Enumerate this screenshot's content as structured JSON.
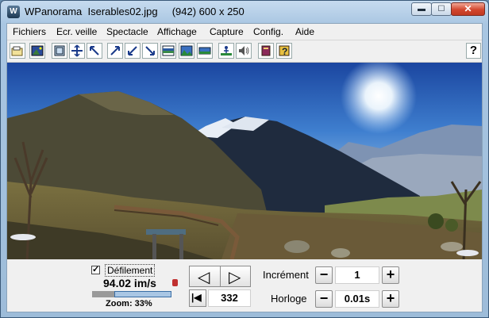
{
  "window": {
    "app_name": "WPanorama",
    "file_name": "Iserables02.jpg",
    "image_info": "(942) 600 x 250",
    "title_full": "WPanorama  Iserables02.jpg     (942) 600 x 250",
    "app_icon_glyph": "W",
    "min_glyph": "▬",
    "max_glyph": "☐",
    "close_glyph": "✕"
  },
  "menu": [
    "Fichiers",
    "Ecr. veille",
    "Spectacle",
    "Affichage",
    "Capture",
    "Config.",
    "Aide"
  ],
  "toolbar": {
    "buttons": [
      "open-icon",
      "image-icon",
      "fit-window-icon",
      "expand-icon",
      "zoom-out-icon",
      "zoom-in-icon",
      "shrink-icon",
      "move-corner-icon",
      "panorama-strip-icon",
      "landscape-icon",
      "flat-panorama-icon",
      "person-icon",
      "sound-icon",
      "book-icon",
      "help-book-icon"
    ],
    "help_glyph": "?"
  },
  "controls": {
    "scroll_label": "Défilement",
    "scroll_checked": true,
    "check_glyph": "✓",
    "fps": "94.02 im/s",
    "zoom": "Zoom: 33%",
    "zoom_level": 0.72,
    "prev_glyph": "◁",
    "next_glyph": "▷",
    "first_glyph": "|◀",
    "position": "332",
    "increment_label": "Incrément",
    "increment_value": "1",
    "clock_label": "Horloge",
    "clock_value": "0.01s",
    "minus_glyph": "−",
    "plus_glyph": "+"
  },
  "colors": {
    "accent": "#3a6ea5",
    "sky_top": "#1b4fa6",
    "sky_horizon": "#a9cbea"
  }
}
